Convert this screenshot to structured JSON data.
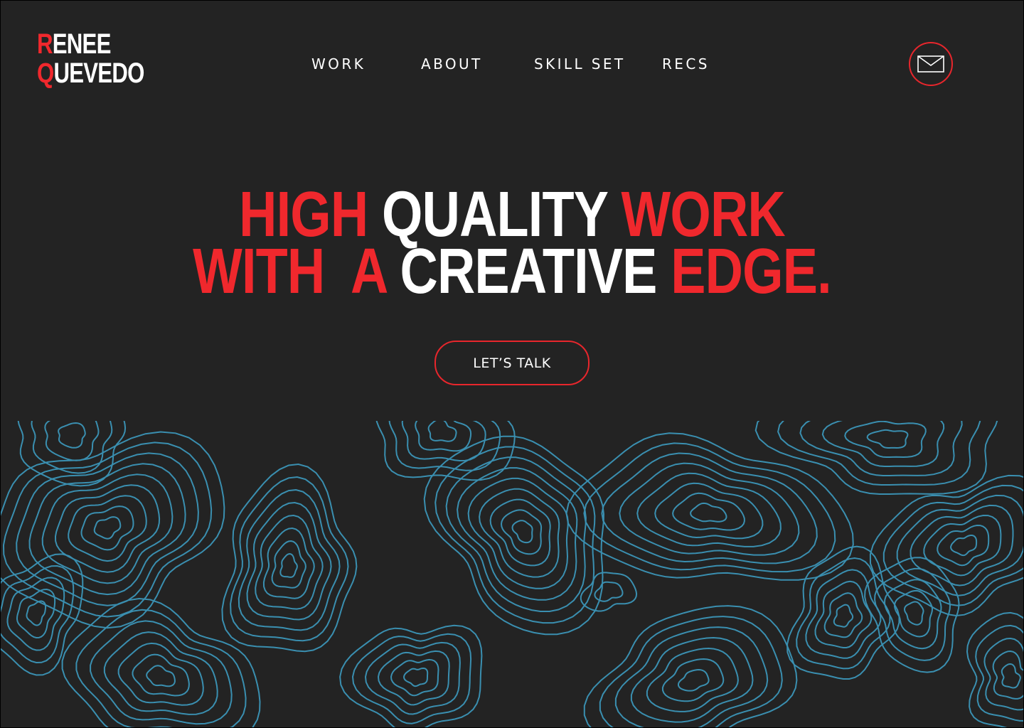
{
  "brand": {
    "first_initial": "R",
    "first_rest": "ENEE",
    "last_initial": "Q",
    "last_rest": "UEVEDO"
  },
  "nav": {
    "items": [
      "WORK",
      "ABOUT",
      "SKILL SET",
      "RECS"
    ]
  },
  "contact": {
    "icon": "mail-icon"
  },
  "hero": {
    "line1": [
      {
        "text": "HIGH",
        "tone": "red"
      },
      {
        "text": "QUALITY",
        "tone": "white"
      },
      {
        "text": "WORK",
        "tone": "red"
      }
    ],
    "line2": [
      {
        "text": "WITH",
        "tone": "red"
      },
      {
        "text": "A",
        "tone": "red"
      },
      {
        "text": "CREATIVE",
        "tone": "white"
      },
      {
        "text": "EDGE.",
        "tone": "red"
      }
    ],
    "cta_label": "LET’S TALK"
  },
  "colors": {
    "background": "#232323",
    "accent": "#f0282d",
    "contour": "#3a8fb0",
    "text": "#ffffff"
  }
}
